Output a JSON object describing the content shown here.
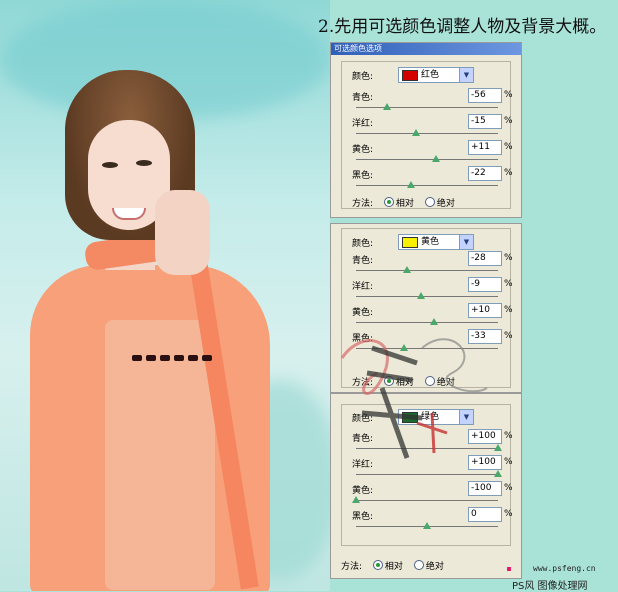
{
  "header": {
    "title": "2.先用可选颜色调整人物及背景大概。"
  },
  "dialogs": [
    {
      "titlebar": "可选颜色选项",
      "color_label": "颜色:",
      "color_name": "红色",
      "swatch": "#d40000",
      "sliders": [
        {
          "label": "青色:",
          "value": "-56",
          "unit": "%",
          "pos": 0.22
        },
        {
          "label": "洋红:",
          "value": "-15",
          "unit": "%",
          "pos": 0.42
        },
        {
          "label": "黄色:",
          "value": "+11",
          "unit": "%",
          "pos": 0.56
        },
        {
          "label": "黑色:",
          "value": "-22",
          "unit": "%",
          "pos": 0.39
        }
      ],
      "method_label": "方法:",
      "method_relative": "相对",
      "method_absolute": "绝对"
    },
    {
      "color_label": "颜色:",
      "color_name": "黄色",
      "swatch": "#f7f000",
      "sliders": [
        {
          "label": "青色:",
          "value": "-28",
          "unit": "%",
          "pos": 0.36
        },
        {
          "label": "洋红:",
          "value": "-9",
          "unit": "%",
          "pos": 0.46
        },
        {
          "label": "黄色:",
          "value": "+10",
          "unit": "%",
          "pos": 0.55
        },
        {
          "label": "黑色:",
          "value": "-33",
          "unit": "%",
          "pos": 0.34
        }
      ],
      "method_label": "方法:",
      "method_relative": "相对",
      "method_absolute": "绝对"
    },
    {
      "color_label": "颜色:",
      "color_name": "绿色",
      "swatch": "#1c6b2a",
      "sliders": [
        {
          "label": "青色:",
          "value": "+100",
          "unit": "%",
          "pos": 1.0
        },
        {
          "label": "洋红:",
          "value": "+100",
          "unit": "%",
          "pos": 1.0
        },
        {
          "label": "黄色:",
          "value": "-100",
          "unit": "%",
          "pos": 0.0
        },
        {
          "label": "黑色:",
          "value": "0",
          "unit": "%",
          "pos": 0.5
        }
      ],
      "method_label": "方法:",
      "method_relative": "相对",
      "method_absolute": "绝对"
    }
  ],
  "footer": {
    "url": "www.psfeng.cn",
    "site": "PS风 图像处理网"
  }
}
